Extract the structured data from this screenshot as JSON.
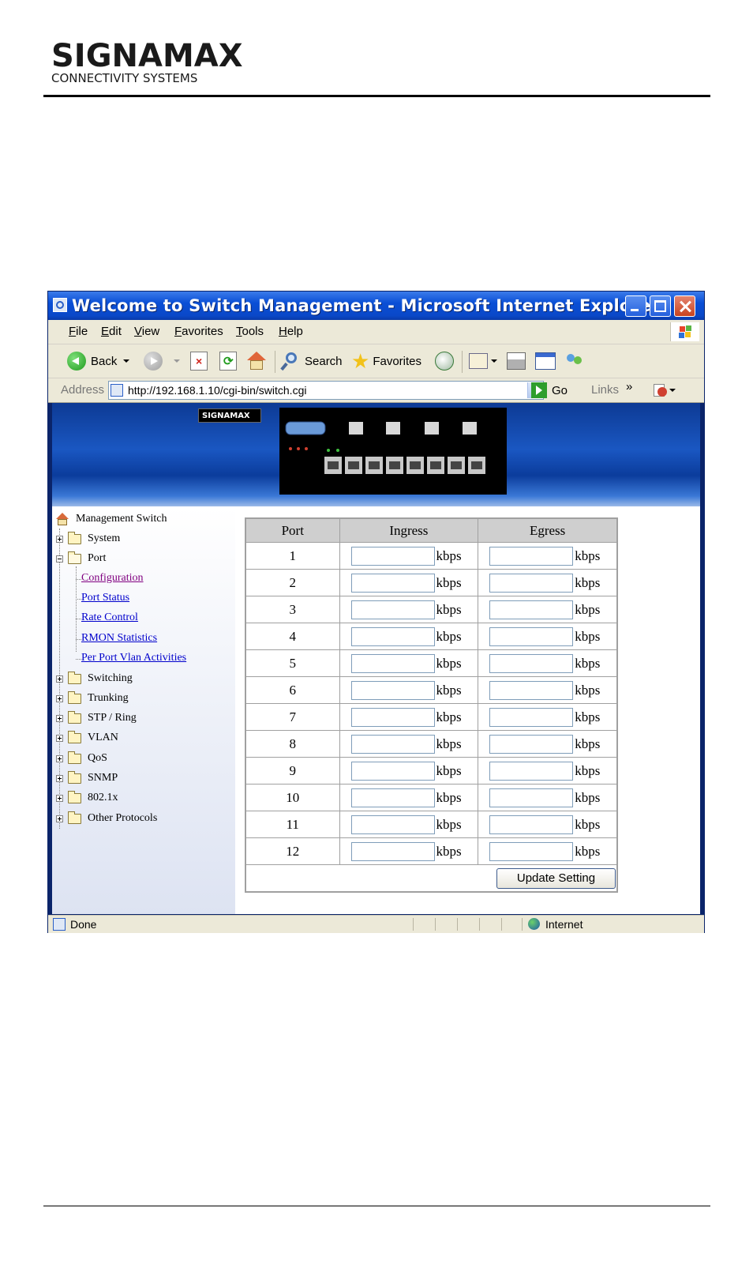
{
  "document": {
    "logo_wordmark": "SIGNAMAX",
    "logo_tagline": "CONNECTIVITY SYSTEMS"
  },
  "window": {
    "title": "Welcome to Switch Management - Microsoft Internet Explorer"
  },
  "menubar": {
    "items": [
      "File",
      "Edit",
      "View",
      "Favorites",
      "Tools",
      "Help"
    ]
  },
  "toolbar": {
    "back_label": "Back",
    "search_label": "Search",
    "favorites_label": "Favorites"
  },
  "addressbar": {
    "label": "Address",
    "url": "http://192.168.1.10/cgi-bin/switch.cgi",
    "go_label": "Go",
    "links_label": "Links",
    "links_chevron": "»"
  },
  "nav": {
    "root_label": "Management Switch",
    "system_label": "System",
    "port_label": "Port",
    "port_children": [
      "Configuration",
      "Port Status",
      "Rate Control",
      "RMON Statistics",
      "Per Port Vlan Activities"
    ],
    "folders": [
      "Switching",
      "Trunking",
      "STP / Ring",
      "VLAN",
      "QoS",
      "SNMP",
      "802.1x",
      "Other Protocols"
    ]
  },
  "rate_table": {
    "headers": [
      "Port",
      "Ingress",
      "Egress"
    ],
    "ports": [
      "1",
      "2",
      "3",
      "4",
      "5",
      "6",
      "7",
      "8",
      "9",
      "10",
      "11",
      "12"
    ],
    "unit": "kbps",
    "update_label": "Update Setting"
  },
  "statusbar": {
    "status": "Done",
    "zone": "Internet"
  },
  "colors": {
    "titlebar": "#0a4fd6",
    "banner": "#1a57c2",
    "link": "#0000cc",
    "visited_link": "#800080",
    "header_cell": "#cfcfcf"
  }
}
